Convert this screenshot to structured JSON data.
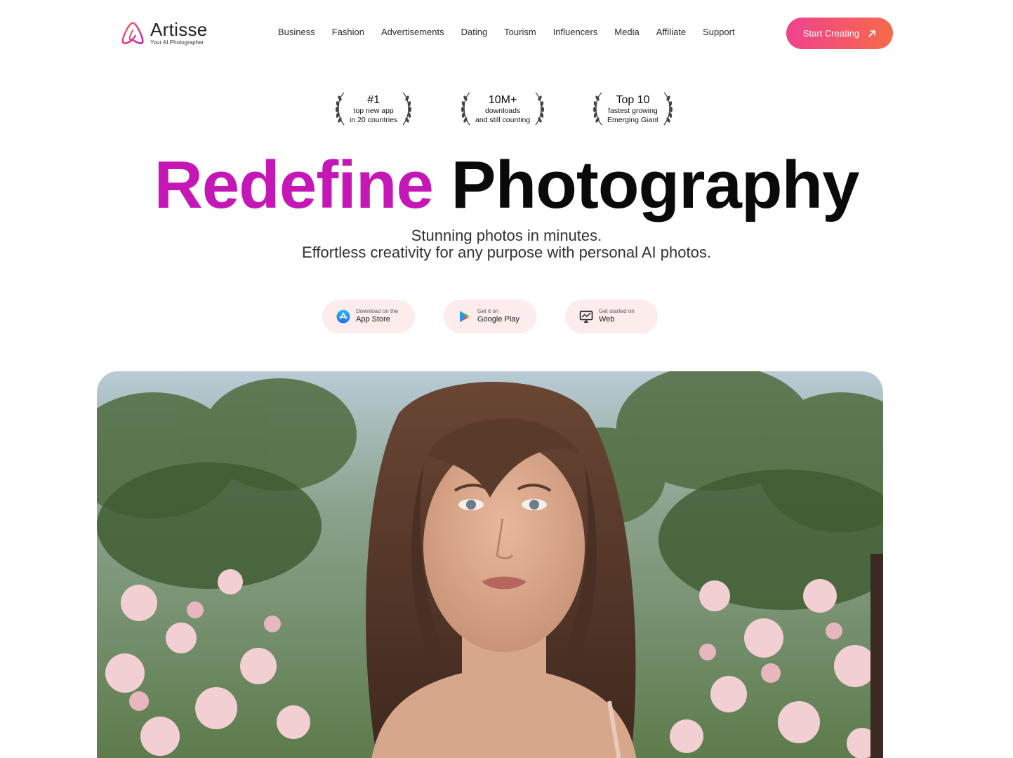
{
  "brand": {
    "name": "Artisse",
    "tagline": "Your AI Photographer"
  },
  "nav": {
    "items": [
      "Business",
      "Fashion",
      "Advertisements",
      "Dating",
      "Tourism",
      "Influencers",
      "Media",
      "Affiliate",
      "Support"
    ]
  },
  "cta": {
    "label": "Start Creating",
    "icon": "arrow-up-right-icon"
  },
  "awards": [
    {
      "title": "#1",
      "line1": "top new app",
      "line2": "in 20 countries"
    },
    {
      "title": "10M+",
      "line1": "downloads",
      "line2": "and still counting"
    },
    {
      "title": "Top 10",
      "line1": "fastest growing",
      "line2": "Emerging Giant"
    }
  ],
  "hero": {
    "headline_accent": "Redefine",
    "headline_rest": "Photography",
    "subtitle_line1": "Stunning photos in minutes.",
    "subtitle_line2": "Effortless creativity for any purpose with personal AI photos.",
    "accent_color": "#c417b6"
  },
  "stores": [
    {
      "small": "Download on the",
      "big": "App Store",
      "icon": "app-store-icon"
    },
    {
      "small": "Get it on",
      "big": "Google Play",
      "icon": "google-play-icon"
    },
    {
      "small": "Get started on",
      "big": "Web",
      "icon": "monitor-icon"
    }
  ],
  "colors": {
    "cta_start": "#f0428f",
    "cta_end": "#f76a4a",
    "store_bg": "#fdecec"
  }
}
